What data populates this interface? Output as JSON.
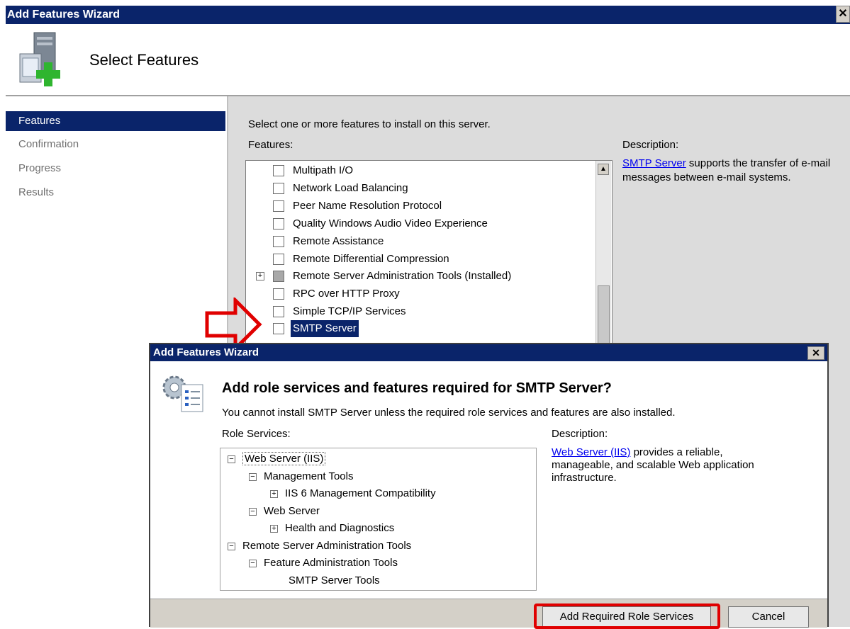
{
  "window": {
    "title": "Add Features Wizard",
    "close": "✕"
  },
  "header": {
    "title": "Select Features"
  },
  "sidebar": {
    "items": [
      {
        "label": "Features",
        "active": true
      },
      {
        "label": "Confirmation",
        "active": false
      },
      {
        "label": "Progress",
        "active": false
      },
      {
        "label": "Results",
        "active": false
      }
    ]
  },
  "main": {
    "instruction": "Select one or more features to install on this server.",
    "features_label": "Features:",
    "description_label": "Description:",
    "description_link": "SMTP Server",
    "description_text": " supports the transfer of e-mail messages between e-mail systems.",
    "features": [
      {
        "label": "Multipath I/O"
      },
      {
        "label": "Network Load Balancing"
      },
      {
        "label": "Peer Name Resolution Protocol"
      },
      {
        "label": "Quality Windows Audio Video Experience"
      },
      {
        "label": "Remote Assistance"
      },
      {
        "label": "Remote Differential Compression"
      },
      {
        "label": "Remote Server Administration Tools  (Installed)"
      },
      {
        "label": "RPC over HTTP Proxy"
      },
      {
        "label": "Simple TCP/IP Services"
      },
      {
        "label": "SMTP Server"
      }
    ]
  },
  "dialog": {
    "title": "Add Features Wizard",
    "question": "Add role services and features required for SMTP Server?",
    "message": "You cannot install SMTP Server unless the required role services and features are also installed.",
    "role_services_label": "Role Services:",
    "description_label": "Description:",
    "description_link": "Web Server (IIS)",
    "description_text": " provides a reliable, manageable, and scalable Web application infrastructure.",
    "tree": [
      {
        "label": "Web Server (IIS)"
      },
      {
        "label": "Management Tools"
      },
      {
        "label": "IIS 6 Management Compatibility"
      },
      {
        "label": "Web Server"
      },
      {
        "label": "Health and Diagnostics"
      },
      {
        "label": "Remote Server Administration Tools"
      },
      {
        "label": "Feature Administration Tools"
      },
      {
        "label": "SMTP Server Tools"
      }
    ],
    "add_button": "Add Required Role Services",
    "cancel_button": "Cancel"
  },
  "colors": {
    "titlebar": "#0a246a",
    "highlight": "#0a246a",
    "annotation": "#e00000"
  }
}
